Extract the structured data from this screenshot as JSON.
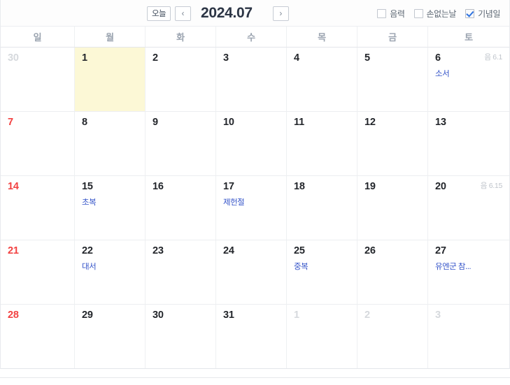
{
  "toolbar": {
    "today_button": "오늘",
    "prev_button": "‹",
    "next_button": "›",
    "month_title": "2024.07",
    "dropdown_icon": "chevron-down-icon",
    "options": [
      {
        "label": "음력",
        "checked": false
      },
      {
        "label": "손없는날",
        "checked": false
      },
      {
        "label": "기념일",
        "checked": true
      }
    ]
  },
  "calendar": {
    "day_headers": [
      "일",
      "월",
      "화",
      "수",
      "목",
      "금",
      "토"
    ],
    "weeks": [
      [
        {
          "day": "30",
          "type": "other"
        },
        {
          "day": "1",
          "type": "normal",
          "today": true
        },
        {
          "day": "2",
          "type": "normal"
        },
        {
          "day": "3",
          "type": "normal"
        },
        {
          "day": "4",
          "type": "normal"
        },
        {
          "day": "5",
          "type": "normal"
        },
        {
          "day": "6",
          "type": "normal",
          "lunar": "음 6.1",
          "event": "소서"
        }
      ],
      [
        {
          "day": "7",
          "type": "sunday"
        },
        {
          "day": "8",
          "type": "normal"
        },
        {
          "day": "9",
          "type": "normal"
        },
        {
          "day": "10",
          "type": "normal"
        },
        {
          "day": "11",
          "type": "normal"
        },
        {
          "day": "12",
          "type": "normal"
        },
        {
          "day": "13",
          "type": "normal"
        }
      ],
      [
        {
          "day": "14",
          "type": "sunday"
        },
        {
          "day": "15",
          "type": "normal",
          "event": "초복"
        },
        {
          "day": "16",
          "type": "normal"
        },
        {
          "day": "17",
          "type": "normal",
          "event": "제헌절"
        },
        {
          "day": "18",
          "type": "normal"
        },
        {
          "day": "19",
          "type": "normal"
        },
        {
          "day": "20",
          "type": "normal",
          "lunar": "음 6.15"
        }
      ],
      [
        {
          "day": "21",
          "type": "sunday"
        },
        {
          "day": "22",
          "type": "normal",
          "event": "대서"
        },
        {
          "day": "23",
          "type": "normal"
        },
        {
          "day": "24",
          "type": "normal"
        },
        {
          "day": "25",
          "type": "normal",
          "event": "중복"
        },
        {
          "day": "26",
          "type": "normal"
        },
        {
          "day": "27",
          "type": "normal",
          "event": "유엔군 참..."
        }
      ],
      [
        {
          "day": "28",
          "type": "sunday"
        },
        {
          "day": "29",
          "type": "normal"
        },
        {
          "day": "30",
          "type": "normal"
        },
        {
          "day": "31",
          "type": "normal"
        },
        {
          "day": "1",
          "type": "other"
        },
        {
          "day": "2",
          "type": "other"
        },
        {
          "day": "3",
          "type": "other"
        }
      ]
    ]
  },
  "colors": {
    "today_highlight": "#fcf8d6",
    "sunday": "#f24141",
    "event_text": "#3554c9",
    "lunar_text": "#bfc4cb",
    "checkbox_check": "#2f73e0"
  }
}
